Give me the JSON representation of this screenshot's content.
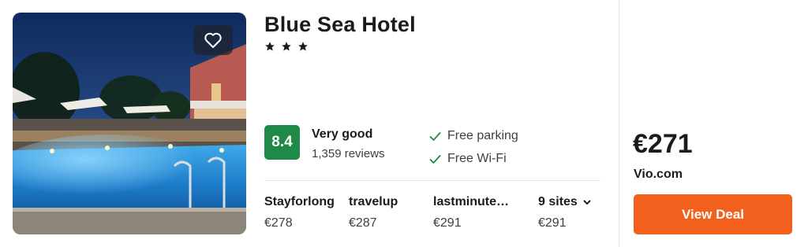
{
  "hotel": {
    "name": "Blue Sea Hotel",
    "stars_text": "★ ★ ★",
    "star_count": 3
  },
  "rating": {
    "score": "8.4",
    "label": "Very good",
    "reviews": "1,359 reviews",
    "color": "#1f8a48"
  },
  "amenities": [
    {
      "label": "Free parking",
      "icon": "check-icon"
    },
    {
      "label": "Free Wi-Fi",
      "icon": "check-icon"
    }
  ],
  "providers": [
    {
      "name": "Stayforlong",
      "price": "€278"
    },
    {
      "name": "travelup",
      "price": "€287"
    },
    {
      "name": "lastminute…",
      "price": "€291"
    }
  ],
  "more_sites": {
    "label": "9 sites",
    "price": "€291",
    "icon": "chevron-down-icon"
  },
  "deal": {
    "price": "€271",
    "seller": "Vio.com",
    "button_label": "View Deal",
    "button_color": "#f2601d"
  },
  "favorite_icon": "heart-icon"
}
